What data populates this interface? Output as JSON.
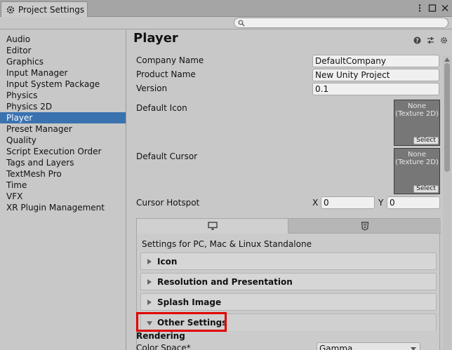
{
  "window": {
    "title": "Project Settings"
  },
  "search": {
    "placeholder": ""
  },
  "sidebar": {
    "items": [
      {
        "label": "Audio"
      },
      {
        "label": "Editor"
      },
      {
        "label": "Graphics"
      },
      {
        "label": "Input Manager"
      },
      {
        "label": "Input System Package"
      },
      {
        "label": "Physics"
      },
      {
        "label": "Physics 2D"
      },
      {
        "label": "Player",
        "selected": true
      },
      {
        "label": "Preset Manager"
      },
      {
        "label": "Quality"
      },
      {
        "label": "Script Execution Order"
      },
      {
        "label": "Tags and Layers"
      },
      {
        "label": "TextMesh Pro"
      },
      {
        "label": "Time"
      },
      {
        "label": "VFX"
      },
      {
        "label": "XR Plugin Management"
      }
    ]
  },
  "main": {
    "title": "Player",
    "header_icons": [
      "help-icon",
      "preset-sliders-icon",
      "settings-gear-icon"
    ],
    "fields": {
      "company_name": {
        "label": "Company Name",
        "value": "DefaultCompany"
      },
      "product_name": {
        "label": "Product Name",
        "value": "New Unity Project"
      },
      "version": {
        "label": "Version",
        "value": "0.1"
      }
    },
    "default_icon": {
      "label": "Default Icon",
      "slot_text": "None\n(Texture 2D)",
      "select_label": "Select"
    },
    "default_cursor": {
      "label": "Default Cursor",
      "slot_text": "None\n(Texture 2D)",
      "select_label": "Select"
    },
    "cursor_hotspot": {
      "label": "Cursor Hotspot",
      "x_label": "X",
      "x_value": "0",
      "y_label": "Y",
      "y_value": "0"
    },
    "platform_tabs": [
      {
        "icon": "desktop-monitor-icon",
        "active": true
      },
      {
        "icon": "webgl-html5-icon",
        "active": false
      }
    ],
    "platform_caption": "Settings for PC, Mac & Linux Standalone",
    "sections": [
      {
        "label": "Icon",
        "expanded": false
      },
      {
        "label": "Resolution and Presentation",
        "expanded": false
      },
      {
        "label": "Splash Image",
        "expanded": false
      },
      {
        "label": "Other Settings",
        "expanded": true
      }
    ],
    "rendering": {
      "heading": "Rendering",
      "color_space_label": "Color Space*",
      "color_space_value": "Gamma"
    }
  },
  "colors": {
    "selection": "#3a72b0",
    "highlight_box": "#e00000",
    "panel_bg": "#c8c8c8"
  }
}
